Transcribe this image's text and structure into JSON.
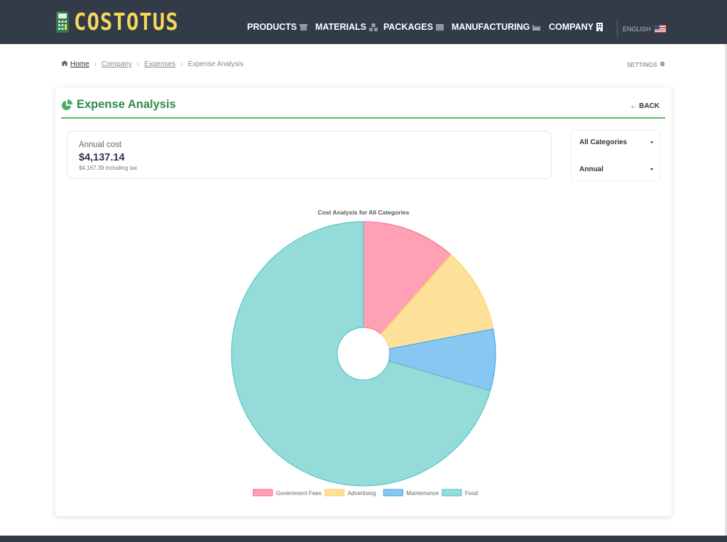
{
  "app": {
    "logo_text": "COSTOTUS"
  },
  "nav": {
    "items": [
      {
        "label": "PRODUCTS",
        "icon": "storefront-icon"
      },
      {
        "label": "MATERIALS",
        "icon": "boxes-icon"
      },
      {
        "label": "PACKAGES",
        "icon": "package-icon"
      },
      {
        "label": "MANUFACTURING",
        "icon": "factory-icon"
      },
      {
        "label": "COMPANY",
        "icon": "building-icon"
      }
    ],
    "language": "ENGLISH"
  },
  "breadcrumb": {
    "items": [
      "Home",
      "Company",
      "Expenses",
      "Expense Analysis"
    ],
    "settings": "SETTINGS"
  },
  "page": {
    "title": "Expense Analysis",
    "back": "BACK"
  },
  "cost": {
    "label": "Annual cost",
    "value": "$4,137.14",
    "tax_note": "$4,167.39 including tax"
  },
  "filters": {
    "category": "All Categories",
    "period": "Annual"
  },
  "colors": {
    "nav_bg": "#333a48",
    "accent_green": "#2e8a4a",
    "logo_yellow": "#f3d85b"
  },
  "chart_data": {
    "type": "pie",
    "title": "Cost Analysis for All Categories",
    "categories": [
      "Government Fees",
      "Advertising",
      "Maintenance",
      "Food"
    ],
    "values": [
      11.5,
      10.5,
      7.5,
      70.5
    ],
    "fill_colors": [
      "#ffa0b4",
      "#fde09a",
      "#88c7f2",
      "#94dbda"
    ],
    "stroke_colors": [
      "#ff6384",
      "#ffcd56",
      "#36a2eb",
      "#4bc0c0"
    ],
    "legend": "bottom"
  }
}
